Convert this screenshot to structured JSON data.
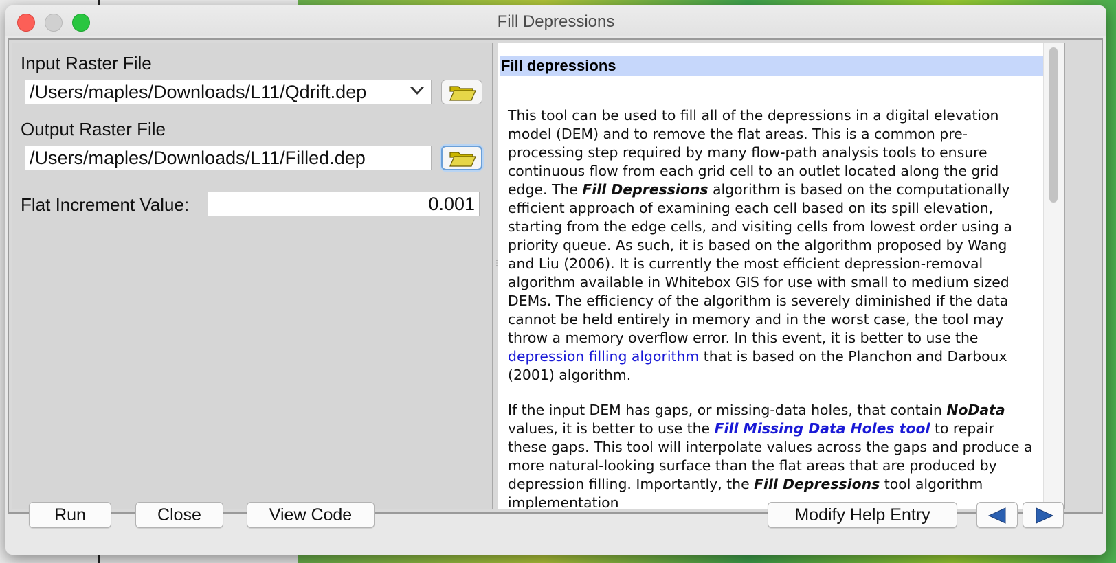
{
  "window": {
    "title": "Fill Depressions"
  },
  "form": {
    "input_label": "Input Raster File",
    "input_value": "/Users/maples/Downloads/L11/Qdrift.dep",
    "output_label": "Output Raster File",
    "output_value": "/Users/maples/Downloads/L11/Filled.dep",
    "flat_label": "Flat Increment Value:",
    "flat_value": "0.001"
  },
  "help": {
    "heading": "Fill depressions",
    "p1": {
      "a": "This tool can be used to fill all of the depressions in a digital elevation model (DEM) and to remove the flat areas. This is a common pre-processing step required by many flow-path analysis tools to ensure continuous flow from each grid cell to an outlet located along the grid edge. The ",
      "b": "Fill Depressions",
      "c": " algorithm is based on the computationally efficient approach of examining each cell based on its spill elevation, starting from the edge cells, and visiting cells from lowest order using a priority queue. As such, it is based on the algorithm proposed by Wang and Liu (2006). It is currently the most efficient depression-removal algorithm available in Whitebox GIS for use with small to medium sized DEMs. The efficiency of the algorithm is severely diminished if the data cannot be held entirely in memory and in the worst case, the tool may throw a memory overflow error. In this event, it is better to use the ",
      "link": "depression filling algorithm",
      "d": " that is based on the Planchon and Darboux (2001) algorithm."
    },
    "p2": {
      "a": "If the input DEM has gaps, or missing-data holes, that contain ",
      "b": "NoData",
      "c": " values, it is better to use the ",
      "link": "Fill Missing Data Holes tool",
      "d": " to repair these gaps. This tool will interpolate values across the gaps and produce a more natural-looking surface than the flat areas that are produced by depression filling. Importantly, the ",
      "e": "Fill Depressions",
      "f": " tool algorithm implementation"
    }
  },
  "buttons": {
    "run": "Run",
    "close": "Close",
    "view_code": "View Code",
    "modify_help": "Modify Help Entry"
  },
  "icons": {
    "browse_input": "folder-open-icon",
    "browse_output": "folder-open-icon",
    "back": "arrow-left-icon",
    "forward": "arrow-right-icon",
    "dropdown": "chevron-down-icon"
  },
  "colors": {
    "help_heading_bg": "#c6d7fb",
    "link": "#1a1ad6",
    "arrow": "#2a5fb0"
  }
}
